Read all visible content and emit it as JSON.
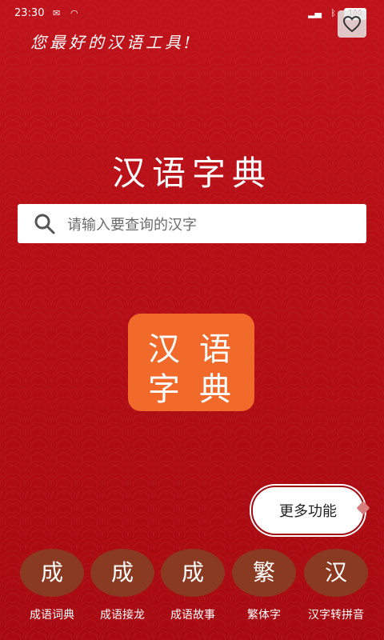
{
  "status": {
    "time": "23:30",
    "battery": "100"
  },
  "header": {
    "slogan": "您最好的汉语工具!"
  },
  "main": {
    "title": "汉语字典",
    "search_placeholder": "请输入要查询的汉字",
    "logo_chars": [
      "汉",
      "语",
      "字",
      "典"
    ],
    "more_button": "更多功能"
  },
  "bottom_nav": [
    {
      "char": "成",
      "label": "成语词典"
    },
    {
      "char": "成",
      "label": "成语接龙"
    },
    {
      "char": "成",
      "label": "成语故事"
    },
    {
      "char": "繁",
      "label": "繁体字"
    },
    {
      "char": "汉",
      "label": "汉字转拼音"
    }
  ]
}
